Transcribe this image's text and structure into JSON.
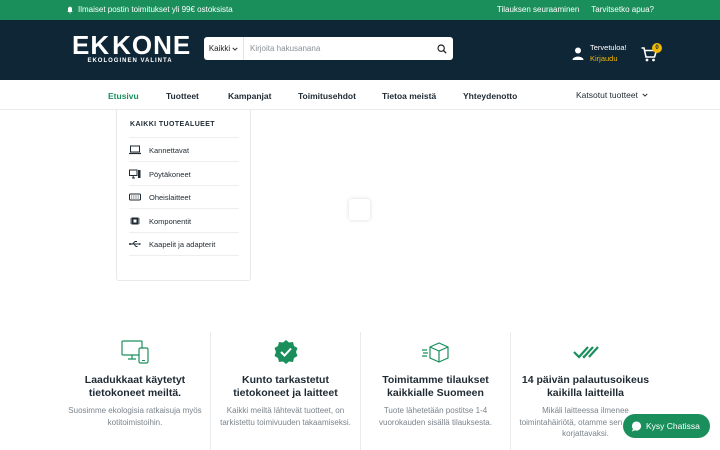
{
  "topbar": {
    "promo": "Ilmaiset postin toimitukset yli 99€ ostoksista",
    "links": [
      "Tilauksen seuraaminen",
      "Tarvitsetko apua?"
    ]
  },
  "logo": {
    "word_left": "EK",
    "word_right": "KONE",
    "tagline": "EKOLOGINEN VALINTA"
  },
  "search": {
    "category": "Kaikki",
    "placeholder": "Kirjoita hakusanana"
  },
  "account": {
    "greeting": "Tervetuloa!",
    "login": "Kirjaudu"
  },
  "cart": {
    "count": "0"
  },
  "nav": {
    "items": [
      "Etusivu",
      "Tuotteet",
      "Kampanjat",
      "Toimitusehdot",
      "Tietoa meistä",
      "Yhteydenotto"
    ],
    "viewed": "Katsotut tuotteet"
  },
  "categories": {
    "title": "KAIKKI TUOTEALUEET",
    "items": [
      "Kannettavat",
      "Pöytäkoneet",
      "Oheislaitteet",
      "Komponentit",
      "Kaapelit ja adapterit"
    ]
  },
  "features": [
    {
      "title": "Laadukkaat käytetyt tietokoneet meiltä.",
      "text": "Suosimme ekologisia ratkaisuja myös kotitoimistoihin."
    },
    {
      "title": "Kunto tarkastetut tietokoneet ja laitteet",
      "text": "Kaikki meiltä lähtevät tuotteet, on tarkistettu toimivuuden takaamiseksi."
    },
    {
      "title": "Toimitamme tilaukset kaikkialle Suomeen",
      "text": "Tuote lähetetään postitse 1-4 vuorokauden sisällä tilauksesta."
    },
    {
      "title": "14 päivän palautusoikeus kaikilla laitteilla",
      "text": "Mikäli laitteessa ilmenee toimintahäiriötä, otamme sen takaisin korjattavaksi."
    }
  ],
  "chat": {
    "label": "Kysy Chatissa"
  },
  "colors": {
    "accent": "#1a8f5c",
    "header": "#0f2636",
    "highlight": "#f2b705"
  }
}
